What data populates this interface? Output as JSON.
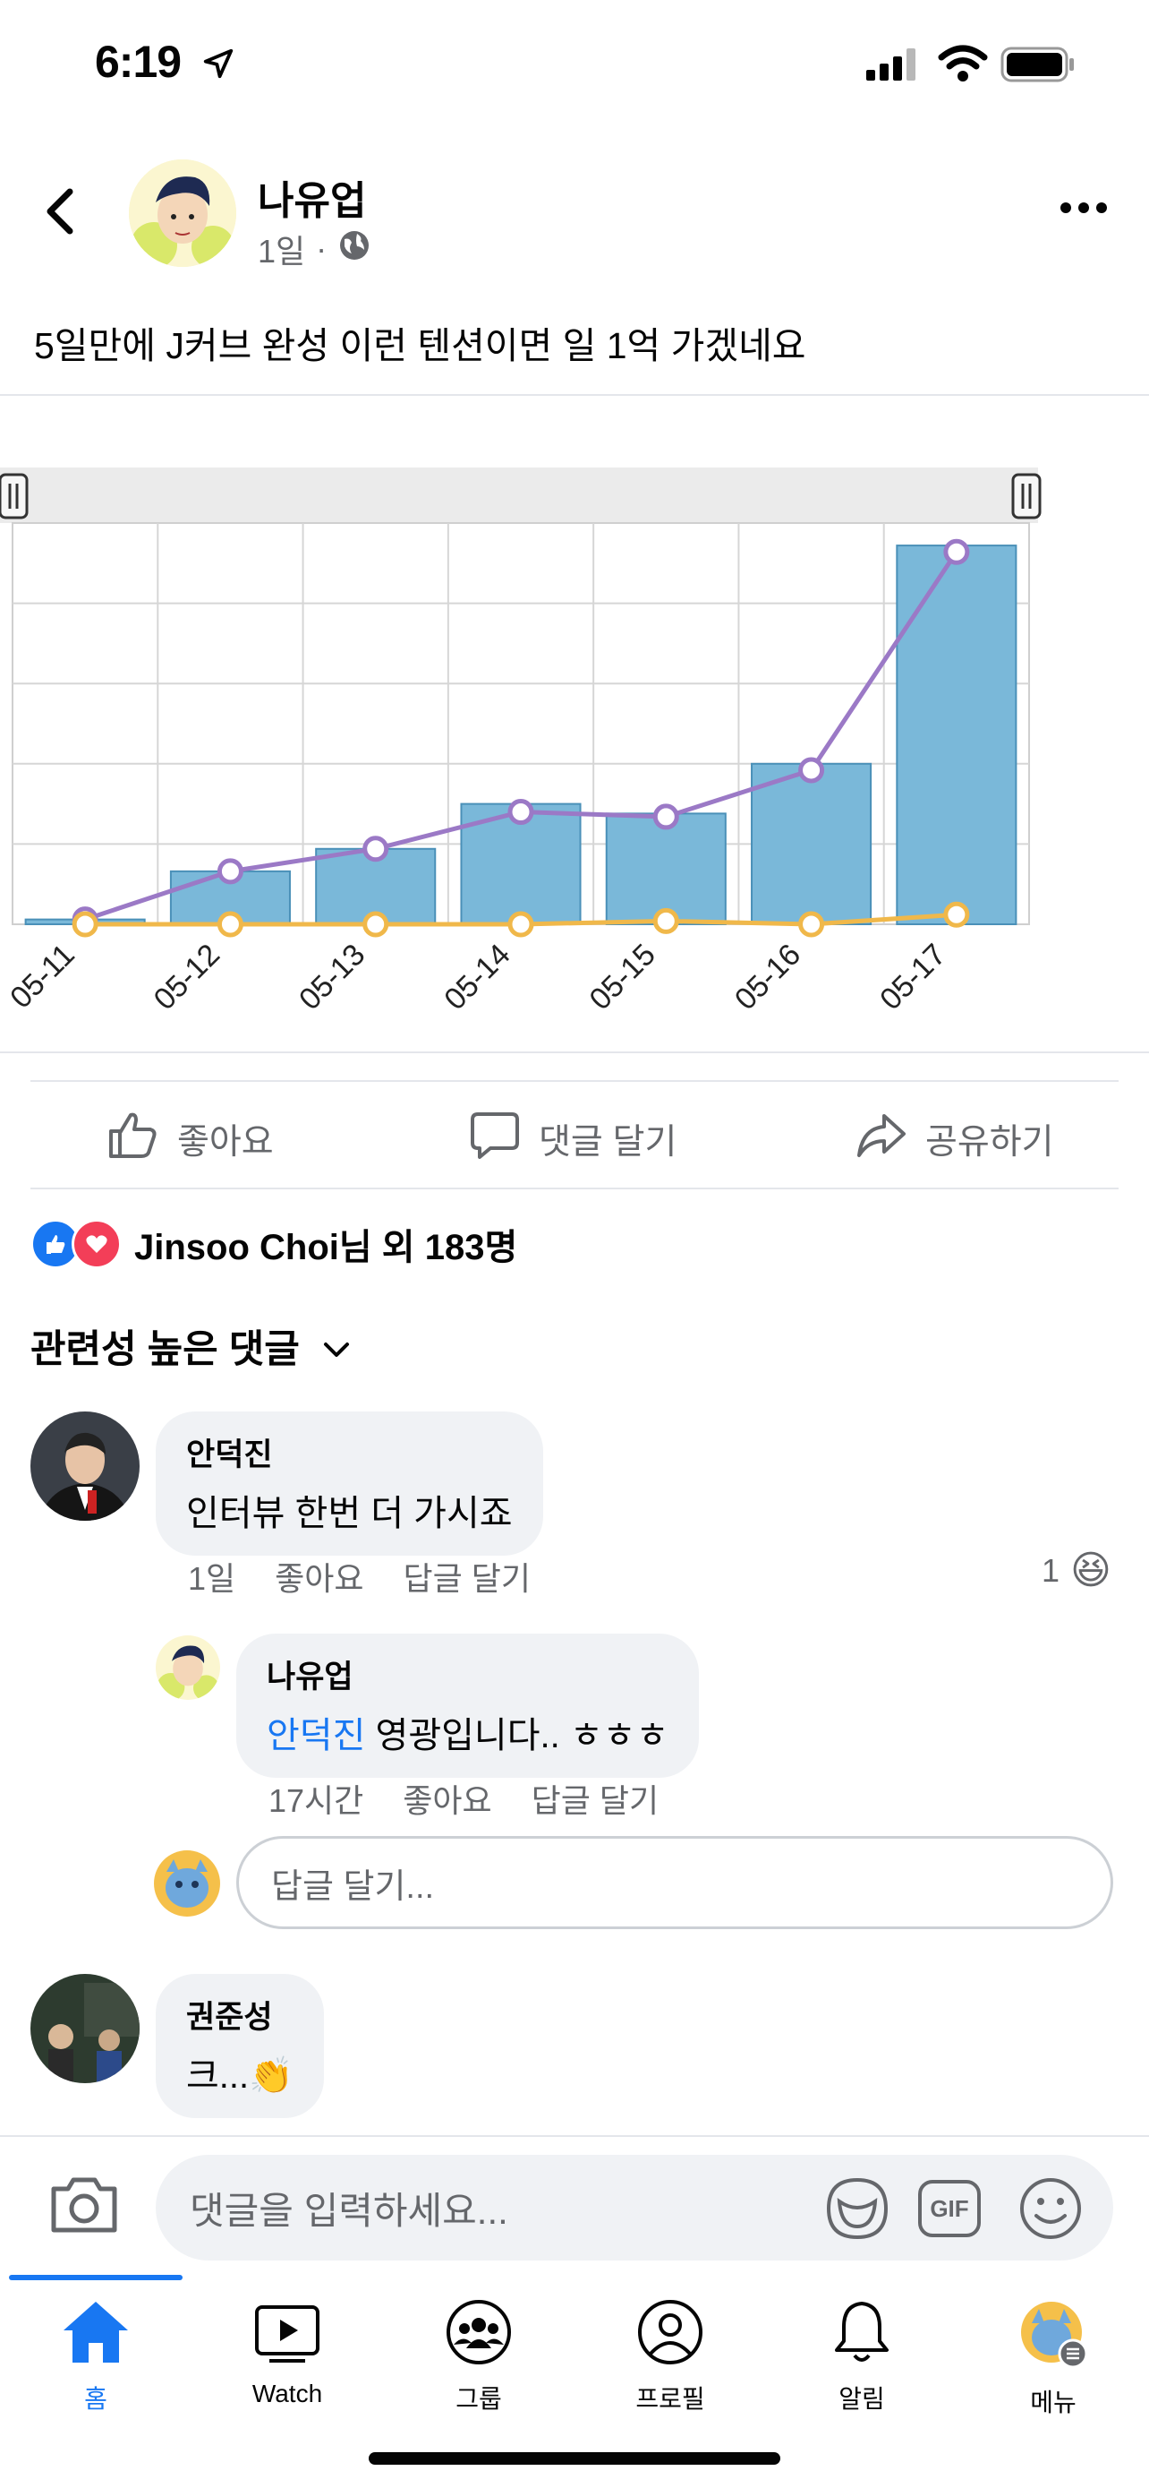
{
  "status_bar": {
    "time": "6:19"
  },
  "post": {
    "author": "나유업",
    "time": "1일",
    "separator": "·",
    "text": "5일만에 J커브 완성 이런 텐션이면 일 1억 가겠네요"
  },
  "chart_data": {
    "type": "bar",
    "categories": [
      "05-11",
      "05-12",
      "05-13",
      "05-14",
      "05-15",
      "05-16",
      "05-17"
    ],
    "series": [
      {
        "values": [
          1.5,
          16.5,
          23.5,
          37.5,
          34.5,
          50,
          118
        ],
        "color": "#7ab8d9"
      },
      {
        "values": [
          1.5,
          16.5,
          23.5,
          35,
          33.5,
          48,
          116
        ],
        "color": "#9b79c6"
      },
      {
        "values": [
          0,
          0,
          0,
          0,
          1,
          0,
          3
        ],
        "color": "#f0b84a"
      }
    ],
    "ylim": [
      0,
      125
    ],
    "grid": true,
    "range_slider": true
  },
  "actions": {
    "like": "좋아요",
    "comment": "댓글 달기",
    "share": "공유하기"
  },
  "reactions": {
    "summary": "Jinsoo Choi님 외 183명"
  },
  "sort": {
    "label": "관련성 높은 댓글"
  },
  "comments": [
    {
      "name": "안덕진",
      "text": "인터뷰 한번 더 가시죠",
      "time": "1일",
      "like": "좋아요",
      "reply": "답글 달기",
      "reaction_count": "1",
      "reaction_emoji": "😆"
    },
    {
      "name": "나유업",
      "mention": "안덕진",
      "text": " 영광입니다.. ㅎㅎㅎ",
      "time": "17시간",
      "like": "좋아요",
      "reply": "답글 달기"
    },
    {
      "name": "권준성",
      "text": "크...👏"
    }
  ],
  "reply_input": {
    "placeholder": "답글 달기..."
  },
  "composer": {
    "placeholder": "댓글을 입력하세요...",
    "gif": "GIF"
  },
  "tabs": [
    {
      "label": "홈",
      "icon": "home-icon",
      "active": true
    },
    {
      "label": "Watch",
      "icon": "watch-icon"
    },
    {
      "label": "그룹",
      "icon": "groups-icon"
    },
    {
      "label": "프로필",
      "icon": "profile-icon"
    },
    {
      "label": "알림",
      "icon": "bell-icon"
    },
    {
      "label": "메뉴",
      "icon": "menu-icon"
    }
  ],
  "colors": {
    "accent": "#1877f2",
    "secondary_text": "#65676b",
    "bubble": "#f0f2f5"
  }
}
